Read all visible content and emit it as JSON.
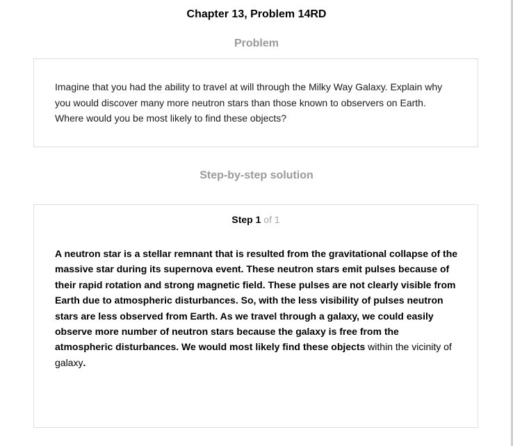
{
  "header": {
    "title": "Chapter 13, Problem 14RD"
  },
  "problem": {
    "heading": "Problem",
    "text": "Imagine that you had the ability to travel at will through the Milky Way Galaxy. Explain why you would discover many more neutron stars than those known to observers on Earth. Where would you be most likely to find these objects?"
  },
  "solution": {
    "heading": "Step-by-step solution",
    "step_label": "Step",
    "step_number": "1",
    "step_of": " of 1",
    "text_bold": "A neutron star is a stellar remnant that is resulted from the gravitational collapse of the massive star during its supernova event. These neutron stars emit pulses because of their rapid rotation and strong magnetic field. These pulses are not clearly visible from Earth due to atmospheric disturbances. So, with the less visibility of pulses neutron stars are less observed from Earth. As we travel through a galaxy, we could easily observe more number of neutron stars because the galaxy is free from the atmospheric disturbances. We would most likely find these objects",
    "text_normal": " within the vicinity of galaxy",
    "text_end": "."
  }
}
